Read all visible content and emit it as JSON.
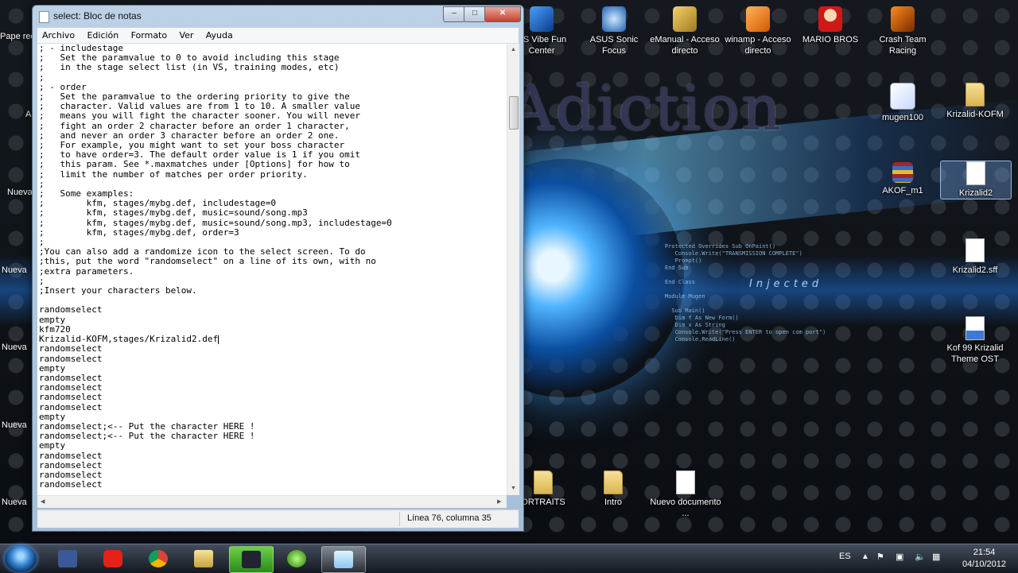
{
  "window": {
    "title": "select: Bloc de notas",
    "minimize": "–",
    "maximize": "□",
    "close": "✕"
  },
  "menu": [
    "Archivo",
    "Edición",
    "Formato",
    "Ver",
    "Ayuda"
  ],
  "editor": {
    "lines": [
      "; - includestage",
      ";   Set the paramvalue to 0 to avoid including this stage",
      ";   in the stage select list (in VS, training modes, etc)",
      ";",
      "; - order",
      ";   Set the paramvalue to the ordering priority to give the",
      ";   character. Valid values are from 1 to 10. A smaller value",
      ";   means you will fight the character sooner. You will never",
      ";   fight an order 2 character before an order 1 character,",
      ";   and never an order 3 character before an order 2 one.",
      ";   For example, you might want to set your boss character",
      ";   to have order=3. The default order value is 1 if you omit",
      ";   this param. See *.maxmatches under [Options] for how to",
      ";   limit the number of matches per order priority.",
      ";",
      ";   Some examples:",
      ";        kfm, stages/mybg.def, includestage=0",
      ";        kfm, stages/mybg.def, music=sound/song.mp3",
      ";        kfm, stages/mybg.def, music=sound/song.mp3, includestage=0",
      ";        kfm, stages/mybg.def, order=3",
      ";",
      ";You can also add a randomize icon to the select screen. To do",
      ";this, put the word \"randomselect\" on a line of its own, with no",
      ";extra parameters.",
      ";",
      ";Insert your characters below.",
      "",
      "randomselect",
      "empty",
      "kfm720",
      "Krizalid-KOFM,stages/Krizalid2.def",
      "randomselect",
      "randomselect",
      "empty",
      "randomselect",
      "randomselect",
      "randomselect",
      "randomselect",
      "empty",
      "randomselect;<-- Put the character HERE !",
      "randomselect;<-- Put the character HERE !",
      "empty",
      "randomselect",
      "randomselect",
      "randomselect",
      "randomselect"
    ],
    "caret_line": 30
  },
  "status": {
    "position": "Línea 76, columna 35"
  },
  "desktop_icons": [
    {
      "name": "vibe-fun-center",
      "label": "US Vibe Fun Center",
      "icon": "app-icon"
    },
    {
      "name": "asus-sonic-focus",
      "label": "ASUS Sonic Focus",
      "icon": "app-icon"
    },
    {
      "name": "emanual",
      "label": "eManual - Acceso directo",
      "icon": "app-icon"
    },
    {
      "name": "winamp",
      "label": "winamp - Acceso directo",
      "icon": "app-icon"
    },
    {
      "name": "mario-bros",
      "label": "MARIO BROS",
      "icon": "game-icon"
    },
    {
      "name": "crash-team-racing",
      "label": "Crash Team Racing",
      "icon": "game-icon"
    },
    {
      "name": "mugen100",
      "label": "mugen100",
      "icon": "app-icon"
    },
    {
      "name": "krizalid-kofm",
      "label": "Krizalid-KOFM",
      "icon": "folder-icon"
    },
    {
      "name": "akof-m1",
      "label": "AKOF_m1",
      "icon": "archive-icon"
    },
    {
      "name": "krizalid2",
      "label": "Krizalid2",
      "icon": "file-icon"
    },
    {
      "name": "krizalid2-sff",
      "label": "Krizalid2.sff",
      "icon": "file-icon"
    },
    {
      "name": "kof99-theme",
      "label": "Kof 99 Krizalid Theme OST",
      "icon": "music-file-icon"
    },
    {
      "name": "portraits",
      "label": "ORTRAITS",
      "icon": "folder-icon"
    },
    {
      "name": "intro",
      "label": "Intro",
      "icon": "folder-icon"
    },
    {
      "name": "nuevo-documento",
      "label": "Nuevo documento ...",
      "icon": "file-icon"
    }
  ],
  "left_partial_labels": [
    "Pape rec",
    "A",
    "Nueva",
    "Nueva",
    "Nueva",
    "Nueva",
    "Nueva"
  ],
  "wallpaper": {
    "title": "Adiction",
    "injected": "Injected"
  },
  "taskbar": {
    "apps": [
      "facebook-icon",
      "youtube-icon",
      "chrome-icon",
      "explorer-icon",
      "game-launcher-icon",
      "media-player-icon",
      "notepad-icon"
    ],
    "language": "ES",
    "time": "21:54",
    "date": "04/10/2012"
  },
  "colors": {
    "accent_blue": "#2d7bc9",
    "close_red": "#c6402c"
  }
}
